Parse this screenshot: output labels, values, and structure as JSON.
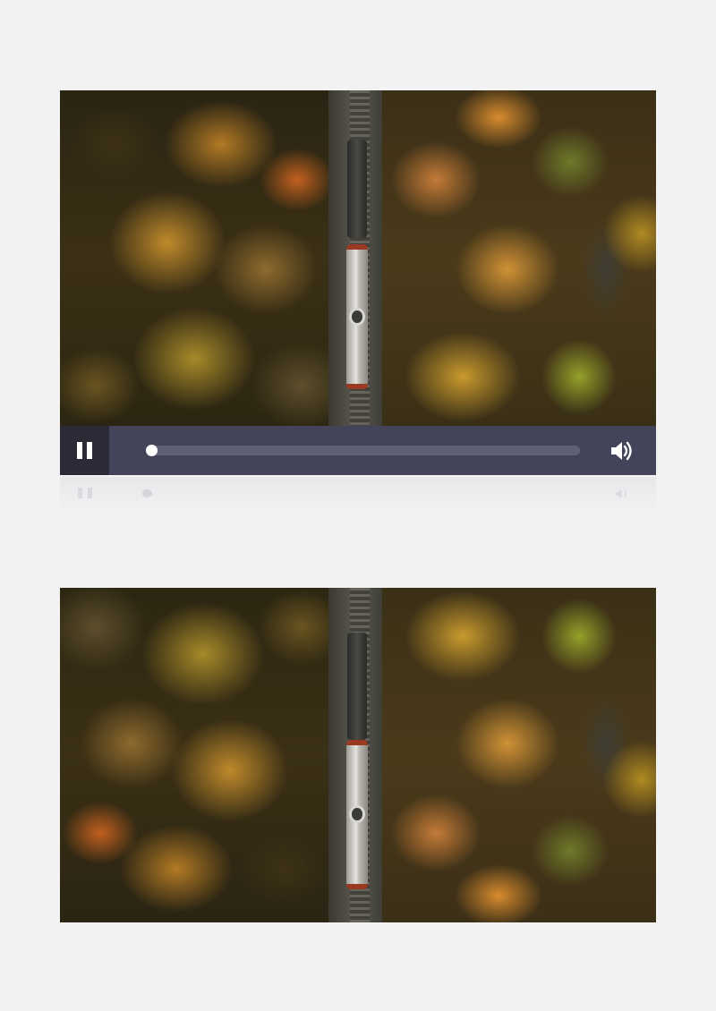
{
  "player": {
    "state": "playing",
    "progress": 0.0,
    "controls": {
      "play_toggle_icon": "pause-icon",
      "volume_icon": "volume-icon"
    }
  },
  "frames": [
    {
      "description_icon": "aerial-forest-train-frame"
    },
    {
      "description_icon": "aerial-forest-train-frame"
    }
  ],
  "colors": {
    "background": "#f2f2f3",
    "control_bar": "#43445a",
    "play_button_bg": "#2a2b36",
    "progress_track": "#5e6076",
    "progress_fill": "#ffffff"
  }
}
